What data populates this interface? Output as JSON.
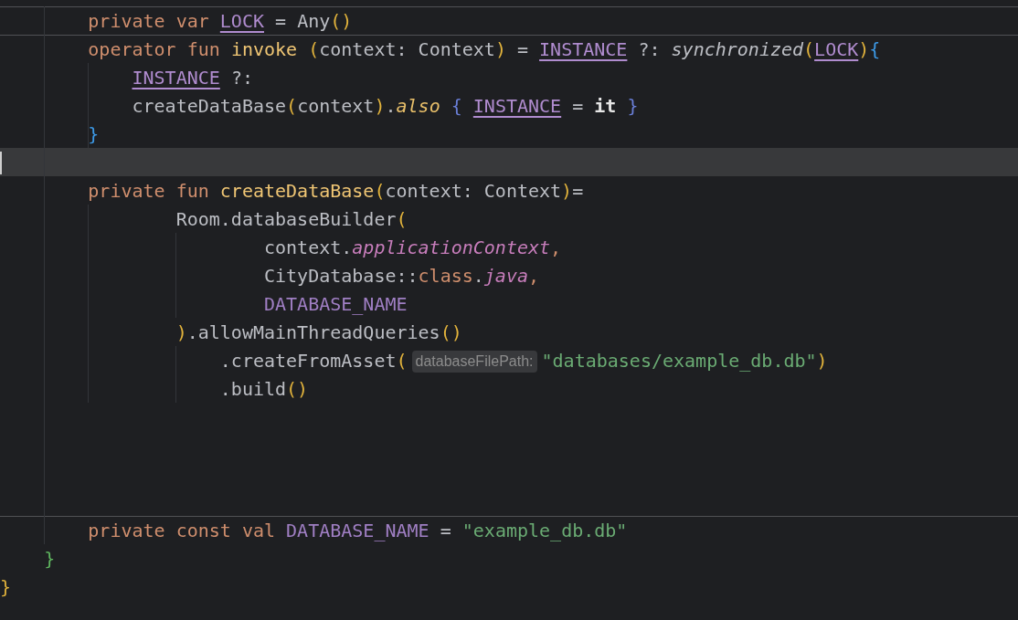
{
  "editor": {
    "lines": [
      {
        "separator_above": true,
        "current": false,
        "tokens": [
          {
            "text": "        private var ",
            "kind": "kw"
          },
          {
            "text": "LOCK",
            "kind": "field"
          },
          {
            "text": " = Any",
            "kind": "plain"
          },
          {
            "text": "()",
            "kind": "paren"
          }
        ]
      },
      {
        "separator_above": true,
        "current": false,
        "tokens": [
          {
            "text": "        operator fun ",
            "kind": "kw"
          },
          {
            "text": "invoke",
            "kind": "fn"
          },
          {
            "text": " (",
            "kind": "paren"
          },
          {
            "text": "context: Context",
            "kind": "plain"
          },
          {
            "text": ")",
            "kind": "paren"
          },
          {
            "text": " = ",
            "kind": "plain"
          },
          {
            "text": "INSTANCE",
            "kind": "field"
          },
          {
            "text": " ?: ",
            "kind": "plain"
          },
          {
            "text": "synchronized",
            "kind": "italic"
          },
          {
            "text": "(",
            "kind": "paren"
          },
          {
            "text": "LOCK",
            "kind": "field"
          },
          {
            "text": ")",
            "kind": "paren"
          },
          {
            "text": "{",
            "kind": "brace_blue"
          }
        ]
      },
      {
        "separator_above": false,
        "current": false,
        "tokens": [
          {
            "text": "            INSTANCE",
            "kind": "field"
          },
          {
            "text": " ?:",
            "kind": "plain"
          }
        ]
      },
      {
        "separator_above": false,
        "current": false,
        "tokens": [
          {
            "text": "            createDataBase",
            "kind": "plain"
          },
          {
            "text": "(",
            "kind": "paren"
          },
          {
            "text": "context",
            "kind": "plain"
          },
          {
            "text": ")",
            "kind": "paren"
          },
          {
            "text": ".",
            "kind": "plain"
          },
          {
            "text": "also",
            "kind": "ext_italic"
          },
          {
            "text": " { ",
            "kind": "brace_violet"
          },
          {
            "text": "INSTANCE",
            "kind": "field"
          },
          {
            "text": " = ",
            "kind": "plain"
          },
          {
            "text": "it",
            "kind": "bold"
          },
          {
            "text": " }",
            "kind": "brace_violet"
          }
        ]
      },
      {
        "separator_above": false,
        "current": false,
        "tokens": [
          {
            "text": "        }",
            "kind": "brace_blue"
          }
        ]
      },
      {
        "separator_above": false,
        "current": true
      },
      {
        "separator_above": false,
        "current": false,
        "tokens": [
          {
            "text": "        private fun ",
            "kind": "kw"
          },
          {
            "text": "createDataBase",
            "kind": "fn"
          },
          {
            "text": "(",
            "kind": "paren"
          },
          {
            "text": "context: Context",
            "kind": "plain"
          },
          {
            "text": ")",
            "kind": "paren"
          },
          {
            "text": "=",
            "kind": "plain"
          }
        ]
      },
      {
        "separator_above": false,
        "current": false,
        "tokens": [
          {
            "text": "                Room.databaseBuilder",
            "kind": "plain"
          },
          {
            "text": "(",
            "kind": "paren"
          }
        ]
      },
      {
        "separator_above": false,
        "current": false,
        "tokens": [
          {
            "text": "                        context.",
            "kind": "plain"
          },
          {
            "text": "applicationContext",
            "kind": "prop_italic"
          },
          {
            "text": ",",
            "kind": "kw"
          }
        ]
      },
      {
        "separator_above": false,
        "current": false,
        "tokens": [
          {
            "text": "                        CityDatabase::",
            "kind": "plain"
          },
          {
            "text": "class",
            "kind": "kw"
          },
          {
            "text": ".",
            "kind": "plain"
          },
          {
            "text": "java",
            "kind": "prop_italic"
          },
          {
            "text": ",",
            "kind": "kw"
          }
        ]
      },
      {
        "separator_above": false,
        "current": false,
        "tokens": [
          {
            "text": "                        DATABASE_NAME",
            "kind": "const"
          }
        ]
      },
      {
        "separator_above": false,
        "current": false,
        "tokens": [
          {
            "text": "                )",
            "kind": "paren"
          },
          {
            "text": ".allowMainThreadQueries",
            "kind": "plain"
          },
          {
            "text": "()",
            "kind": "paren"
          }
        ]
      },
      {
        "separator_above": false,
        "current": false,
        "tokens": [
          {
            "text": "                    .createFromAsset",
            "kind": "plain"
          },
          {
            "text": "(",
            "kind": "paren"
          },
          {
            "text": "databaseFilePath:",
            "kind": "hint"
          },
          {
            "text": "\"databases/example_db.db\"",
            "kind": "string"
          },
          {
            "text": ")",
            "kind": "paren"
          }
        ]
      },
      {
        "separator_above": false,
        "current": false,
        "tokens": [
          {
            "text": "                    .build",
            "kind": "plain"
          },
          {
            "text": "()",
            "kind": "paren"
          }
        ]
      },
      {
        "separator_above": false,
        "current": false
      },
      {
        "separator_above": false,
        "current": false
      },
      {
        "separator_above": false,
        "current": false
      },
      {
        "separator_above": false,
        "current": false
      },
      {
        "separator_above": true,
        "current": false,
        "tokens": [
          {
            "text": "        private const val ",
            "kind": "kw"
          },
          {
            "text": "DATABASE_NAME",
            "kind": "const"
          },
          {
            "text": " = ",
            "kind": "plain"
          },
          {
            "text": "\"example_db.db\"",
            "kind": "string"
          }
        ]
      },
      {
        "separator_above": false,
        "current": false,
        "tokens": [
          {
            "text": "    }",
            "kind": "brace_green"
          }
        ]
      },
      {
        "separator_above": false,
        "current": false,
        "tokens": [
          {
            "text": "}",
            "kind": "brace_gold"
          }
        ]
      }
    ]
  }
}
